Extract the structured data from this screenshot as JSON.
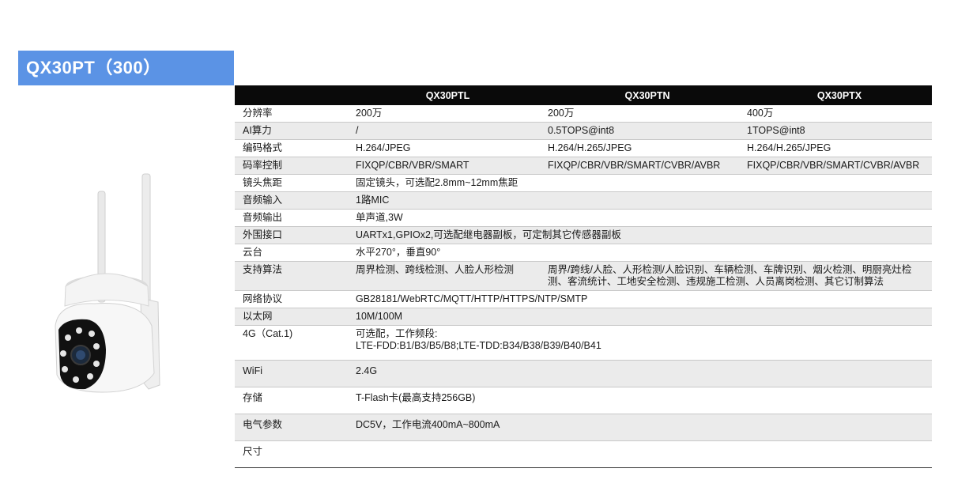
{
  "header": {
    "title": "QX30PT（300）"
  },
  "table": {
    "columns": [
      "QX30PTL",
      "QX30PTN",
      "QX30PTX"
    ],
    "rows": [
      {
        "label": "分辨率",
        "v1": "200万",
        "v2": "200万",
        "v3": "400万"
      },
      {
        "label": "AI算力",
        "v1": "/",
        "v2": "0.5TOPS@int8",
        "v3": "1TOPS@int8"
      },
      {
        "label": "编码格式",
        "v1": "H.264/JPEG",
        "v2": "H.264/H.265/JPEG",
        "v3": "H.264/H.265/JPEG"
      },
      {
        "label": "码率控制",
        "v1": "FIXQP/CBR/VBR/SMART",
        "v2": "FIXQP/CBR/VBR/SMART/CVBR/AVBR",
        "v3": "FIXQP/CBR/VBR/SMART/CVBR/AVBR"
      },
      {
        "label": "镜头焦距",
        "span": "固定镜头，可选配2.8mm~12mm焦距"
      },
      {
        "label": "音频输入",
        "span": "1路MIC"
      },
      {
        "label": "音频输出",
        "span": "单声道,3W"
      },
      {
        "label": "外围接口",
        "span": "UARTx1,GPIOx2,可选配继电器副板，可定制其它传感器副板"
      },
      {
        "label": "云台",
        "span": "水平270°，垂直90°"
      },
      {
        "label": "支持算法",
        "v1": "周界检测、跨线检测、人脸人形检测",
        "v23": "周界/跨线/人脸、人形检测/人脸识别、车辆检测、车牌识别、烟火检测、明厨亮灶检测、客流统计、工地安全检测、违规施工检测、人员离岗检测、其它订制算法"
      },
      {
        "label": "网络协议",
        "span": "GB28181/WebRTC/MQTT/HTTP/HTTPS/NTP/SMTP"
      },
      {
        "label": "以太网",
        "span": "10M/100M"
      },
      {
        "label": "4G（Cat.1)",
        "span_line1": "可选配，工作频段:",
        "span_line2": "LTE-FDD:B1/B3/B5/B8;LTE-TDD:B34/B38/B39/B40/B41"
      },
      {
        "label": "WiFi",
        "span": "2.4G"
      },
      {
        "label": "存储",
        "span": "T-Flash卡(最高支持256GB)"
      },
      {
        "label": "电气参数",
        "span": "DC5V，工作电流400mA~800mA"
      },
      {
        "label": "尺寸",
        "span": ""
      }
    ]
  },
  "colors": {
    "title_bg": "#5b93e5",
    "header_bg": "#0a0a0a",
    "row_alt": "#ebebeb"
  }
}
